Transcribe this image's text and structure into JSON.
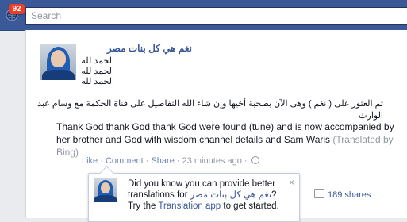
{
  "header": {
    "notifications_count": "92",
    "search_placeholder": "Search"
  },
  "post": {
    "author": "نغم هي كل بنات مصر",
    "intro_lines": [
      "الحمد لله",
      "الحمد لله",
      "الحمد لله"
    ],
    "arabic_text": "تم العثور على ( نغم ) وهى الآن بصحبة أخيها وإن شاء الله التفاصيل على قناة الحكمة مع وسام عبد الوارث",
    "english_text": "Thank God thank God thank God were found (tune) and is now accompanied by her brother and God with wisdom channel details and Sam Waris",
    "translated_note": "(Translated by Bing)",
    "actions": {
      "like": "Like",
      "comment": "Comment",
      "share": "Share",
      "time": "23 minutes ago"
    }
  },
  "translation_tip": {
    "text_prefix": "Did you know you can provide better translations for ",
    "page_name": "نغم هي كل بنات مصر",
    "text_middle": "? Try the ",
    "app_link": "Translation app",
    "text_suffix": " to get started.",
    "close": "×"
  },
  "shares": {
    "label": "189 shares"
  },
  "colors": {
    "topbar": "#3b5998",
    "link": "#3b5998",
    "badge": "#f03d25"
  }
}
